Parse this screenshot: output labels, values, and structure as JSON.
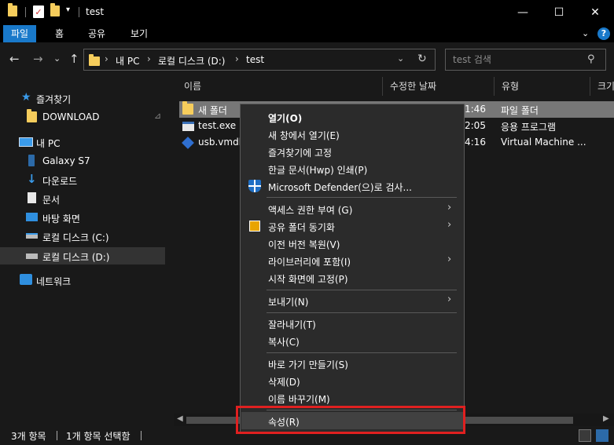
{
  "window": {
    "title": "test",
    "minimize_glyph": "—",
    "maximize_glyph": "☐",
    "close_glyph": "✕"
  },
  "ribbon": {
    "tabs": [
      "파일",
      "홈",
      "공유",
      "보기"
    ],
    "expand_glyph": "⌄",
    "help_glyph": "?"
  },
  "address": {
    "back_glyph": "←",
    "forward_glyph": "→",
    "recent_glyph": "⌄",
    "up_glyph": "↑",
    "crumbs": [
      "내 PC",
      "로컬 디스크 (D:)",
      "test"
    ],
    "crumb_sep": "›",
    "dropdown_glyph": "⌄",
    "refresh_glyph": "↻"
  },
  "search": {
    "placeholder": "test 검색",
    "icon_glyph": "⚲"
  },
  "nav_pane": {
    "items": [
      {
        "label": "즐겨찾기",
        "icon": "star-icon"
      },
      {
        "label": "DOWNLOAD",
        "icon": "folder-icon"
      },
      {
        "label": "내 PC",
        "icon": "computer-icon"
      },
      {
        "label": "Galaxy S7",
        "icon": "phone-icon"
      },
      {
        "label": "다운로드",
        "icon": "download-icon"
      },
      {
        "label": "문서",
        "icon": "document-icon"
      },
      {
        "label": "바탕 화면",
        "icon": "desktop-icon"
      },
      {
        "label": "로컬 디스크 (C:)",
        "icon": "drive-icon"
      },
      {
        "label": "로컬 디스크 (D:)",
        "icon": "drive-icon"
      },
      {
        "label": "네트워크",
        "icon": "network-icon"
      }
    ],
    "pin_glyph": "📌"
  },
  "columns": [
    "이름",
    "수정한 날짜",
    "유형",
    "크기"
  ],
  "files": [
    {
      "name": "새 폴더",
      "date": "1:46",
      "type": "파일 폴더",
      "icon": "folder-icon"
    },
    {
      "name": "test.exe",
      "date": "2:05",
      "type": "응용 프로그램",
      "icon": "exe-icon"
    },
    {
      "name": "usb.vmdk",
      "date": "4:16",
      "type": "Virtual Machine ...",
      "icon": "cube-icon"
    }
  ],
  "context_menu": {
    "items": [
      {
        "label": "열기(O)"
      },
      {
        "label": "새 창에서 열기(E)"
      },
      {
        "label": "즐겨찾기에 고정"
      },
      {
        "label": "한글 문서(Hwp) 인쇄(P)"
      },
      {
        "label": "Microsoft Defender(으)로 검사..."
      },
      {
        "label": "액세스 권한 부여 (G)"
      },
      {
        "label": "공유 폴더 동기화"
      },
      {
        "label": "이전 버전 복원(V)"
      },
      {
        "label": "라이브러리에 포함(I)"
      },
      {
        "label": "시작 화면에 고정(P)"
      },
      {
        "label": "보내기(N)"
      },
      {
        "label": "잘라내기(T)"
      },
      {
        "label": "복사(C)"
      },
      {
        "label": "바로 가기 만들기(S)"
      },
      {
        "label": "삭제(D)"
      },
      {
        "label": "이름 바꾸기(M)"
      },
      {
        "label": "속성(R)"
      }
    ],
    "submenu_glyph": "›"
  },
  "hscroll": {
    "left_glyph": "◀",
    "right_glyph": "▶"
  },
  "status_bar": {
    "item_count": "3개 항목",
    "selection": "1개 항목 선택함"
  },
  "colors": {
    "accent": "#1979ca",
    "highlight_box": "#e02020",
    "folder": "#f6cd5c"
  }
}
